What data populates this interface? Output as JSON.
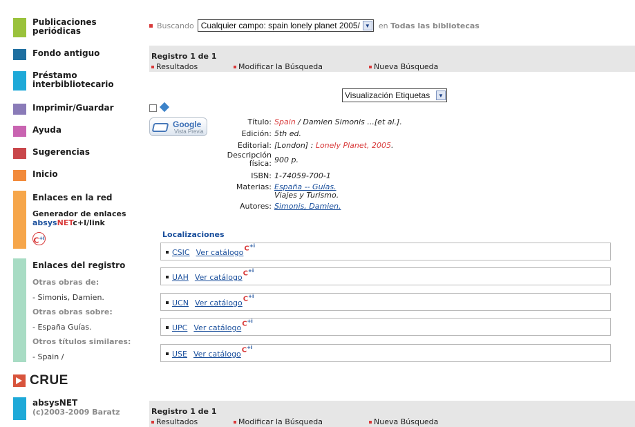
{
  "sidebar": {
    "nav": [
      {
        "label_line1": "Publicaciones",
        "label_line2": "periódicas",
        "color": "#9ac23c"
      },
      {
        "label_line1": "Fondo antiguo",
        "label_line2": "",
        "color": "#1e6fa0"
      },
      {
        "label_line1": "Préstamo",
        "label_line2": "interbibliotecario",
        "color": "#1ea9d8"
      },
      {
        "label_line1": "Imprimir/Guardar",
        "label_line2": "",
        "color": "#8a7bb8"
      },
      {
        "label_line1": "Ayuda",
        "label_line2": "",
        "color": "#c964b1"
      },
      {
        "label_line1": "Sugerencias",
        "label_line2": "",
        "color": "#c9464a"
      },
      {
        "label_line1": "Inicio",
        "label_line2": "",
        "color": "#f28a3b"
      }
    ],
    "links_title": "Enlaces en la red",
    "generator_title": "Generador de enlaces",
    "generator_brand_a": "absys",
    "generator_brand_b": "NET",
    "generator_brand_c": "c+I/link",
    "cplus_label": "C",
    "cplus_sup": "+i",
    "registro_title": "Enlaces del registro",
    "otras_obras_de": "Otras obras de:",
    "author_link": "- Simonis, Damien.",
    "otras_obras_sobre": "Otras obras sobre:",
    "subject_link": "- España Guías.",
    "otros_titulos": "Otros títulos similares:",
    "title_link": "- Spain /",
    "crue": "CRUE",
    "footer_brand": "absysNET",
    "footer_copy": "(c)2003-2009 Baratz"
  },
  "search": {
    "label": "Buscando",
    "value": "Cualquier campo: spain lonely planet 2005/",
    "suffix_en": "en",
    "suffix_scope": "Todas las bibliotecas"
  },
  "record_nav": {
    "title": "Registro 1 de 1",
    "resultados": "Resultados",
    "modificar": "Modificar la Búsqueda",
    "nueva": "Nueva Búsqueda"
  },
  "view_select": "Visualización Etiquetas",
  "google_book": {
    "brand": "Google",
    "sub": "Vista Previa"
  },
  "record": {
    "titulo_label": "Título:",
    "titulo_link": "Spain",
    "titulo_rest": "/ Damien Simonis ...[et al.].",
    "edicion_label": "Edición:",
    "edicion": "5th ed.",
    "editorial_label": "Editorial:",
    "editorial_place": "[London] :",
    "editorial_link": "Lonely Planet, 2005",
    "editorial_end": ".",
    "descripcion_label_1": "Descripción",
    "descripcion_label_2": "física:",
    "descripcion": "900 p.",
    "isbn_label": "ISBN:",
    "isbn": "1-74059-700-1",
    "materias_label": "Materias:",
    "materia_link": "España -- Guías.",
    "materia_2": "Viajes y Turismo.",
    "autores_label": "Autores:",
    "autor_link": "Simonis, Damien."
  },
  "locations": {
    "title": "Localizaciones",
    "catalog_label": "Ver catálogo",
    "items": [
      "CSIC",
      "UAH",
      "UCN",
      "UPC",
      "USE"
    ]
  }
}
